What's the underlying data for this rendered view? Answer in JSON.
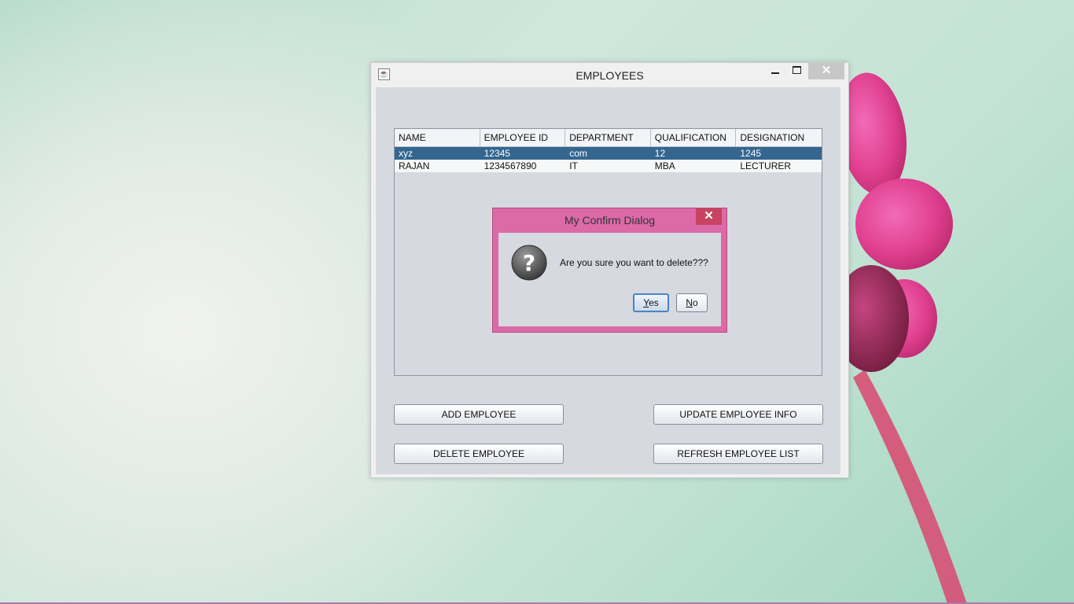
{
  "window": {
    "title": "EMPLOYEES",
    "controls": {
      "minimize": "minimize",
      "maximize": "maximize",
      "close": "✕"
    }
  },
  "table": {
    "columns": [
      "NAME",
      "EMPLOYEE ID",
      "DEPARTMENT",
      "QUALIFICATION",
      "DESIGNATION"
    ],
    "rows": [
      [
        "xyz",
        "12345",
        "com",
        "12",
        "1245"
      ],
      [
        "RAJAN",
        "1234567890",
        "IT",
        "MBA",
        "LECTURER"
      ]
    ],
    "selected_row": 0
  },
  "buttons": {
    "add": "ADD EMPLOYEE",
    "update": "UPDATE EMPLOYEE INFO",
    "delete": "DELETE EMPLOYEE",
    "refresh": "REFRESH EMPLOYEE LIST"
  },
  "dialog": {
    "title": "My Confirm Dialog",
    "close": "✕",
    "icon": "question-icon",
    "message": "Are you sure you want to delete???",
    "yes": {
      "mnemonic": "Y",
      "rest": "es"
    },
    "no": {
      "mnemonic": "N",
      "rest": "o"
    }
  },
  "colors": {
    "selection": "#34668f",
    "dialog_frame": "#dc6aa8",
    "dialog_close": "#c84361",
    "client_bg": "#d6d9e0"
  }
}
